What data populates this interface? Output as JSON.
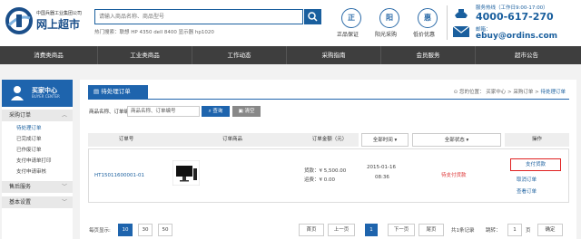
{
  "header": {
    "logo_sub": "中国兵器工业集团公司",
    "logo_main": "网上超市",
    "search_placeholder": "请输入商品名称、商品型号",
    "hot_search": "热门搜索：联想 HP 4350 dell 8400 显示器 hp1020",
    "badges": [
      {
        "glyph": "正",
        "label": "正品保证"
      },
      {
        "glyph": "阳",
        "label": "阳光采购"
      },
      {
        "glyph": "惠",
        "label": "低价优惠"
      }
    ],
    "phone_label": "服务热线（工作日9:00-17:00）",
    "phone": "4000-617-270",
    "email_label": "邮箱：",
    "email": "ebuy@ordins.com"
  },
  "nav": [
    "消费类商品",
    "工业类商品",
    "工作动态",
    "采购指南",
    "会员服务",
    "超市公告"
  ],
  "sidebar": {
    "title": "买家中心",
    "subtitle": "BUYER CENTER",
    "sections": [
      {
        "label": "采购订单",
        "items": [
          "待处理订单",
          "已完成订单",
          "已作废订单",
          "支付申请单打印",
          "支付申请审核"
        ]
      },
      {
        "label": "售后服务",
        "items": []
      },
      {
        "label": "基本设置",
        "items": []
      }
    ]
  },
  "main": {
    "panel_title": "待处理订单",
    "breadcrumb_prefix": "您的位置：",
    "breadcrumb": [
      "买家中心",
      "采购订单",
      "待处理订单"
    ],
    "filter_label": "商品名称、订单编号",
    "filter_value": "商品名称、订单编号",
    "query_label": "查询",
    "clear_label": "清空",
    "columns": [
      "订单号",
      "订单商品",
      "订单金额（元）",
      "全部时间",
      "全部状态",
      "操作"
    ],
    "order": {
      "id": "HT15011600001-01",
      "goods_label": "货款：¥ 5,500.00",
      "freight_label": "运费：¥ 0.00",
      "date": "2015-01-16",
      "time": "08:36",
      "status": "待支付货款",
      "actions": [
        "支付货款",
        "取消订单",
        "查看订单"
      ]
    },
    "pagination": {
      "per_page_label": "每页显示:",
      "sizes": [
        "10",
        "30",
        "50"
      ],
      "first": "首页",
      "prev": "上一页",
      "current": "1",
      "next": "下一页",
      "last": "尾页",
      "total": "共1条记录",
      "jump_label": "跳转：",
      "jump_value": "1",
      "page_unit": "页",
      "confirm": "确定"
    }
  }
}
